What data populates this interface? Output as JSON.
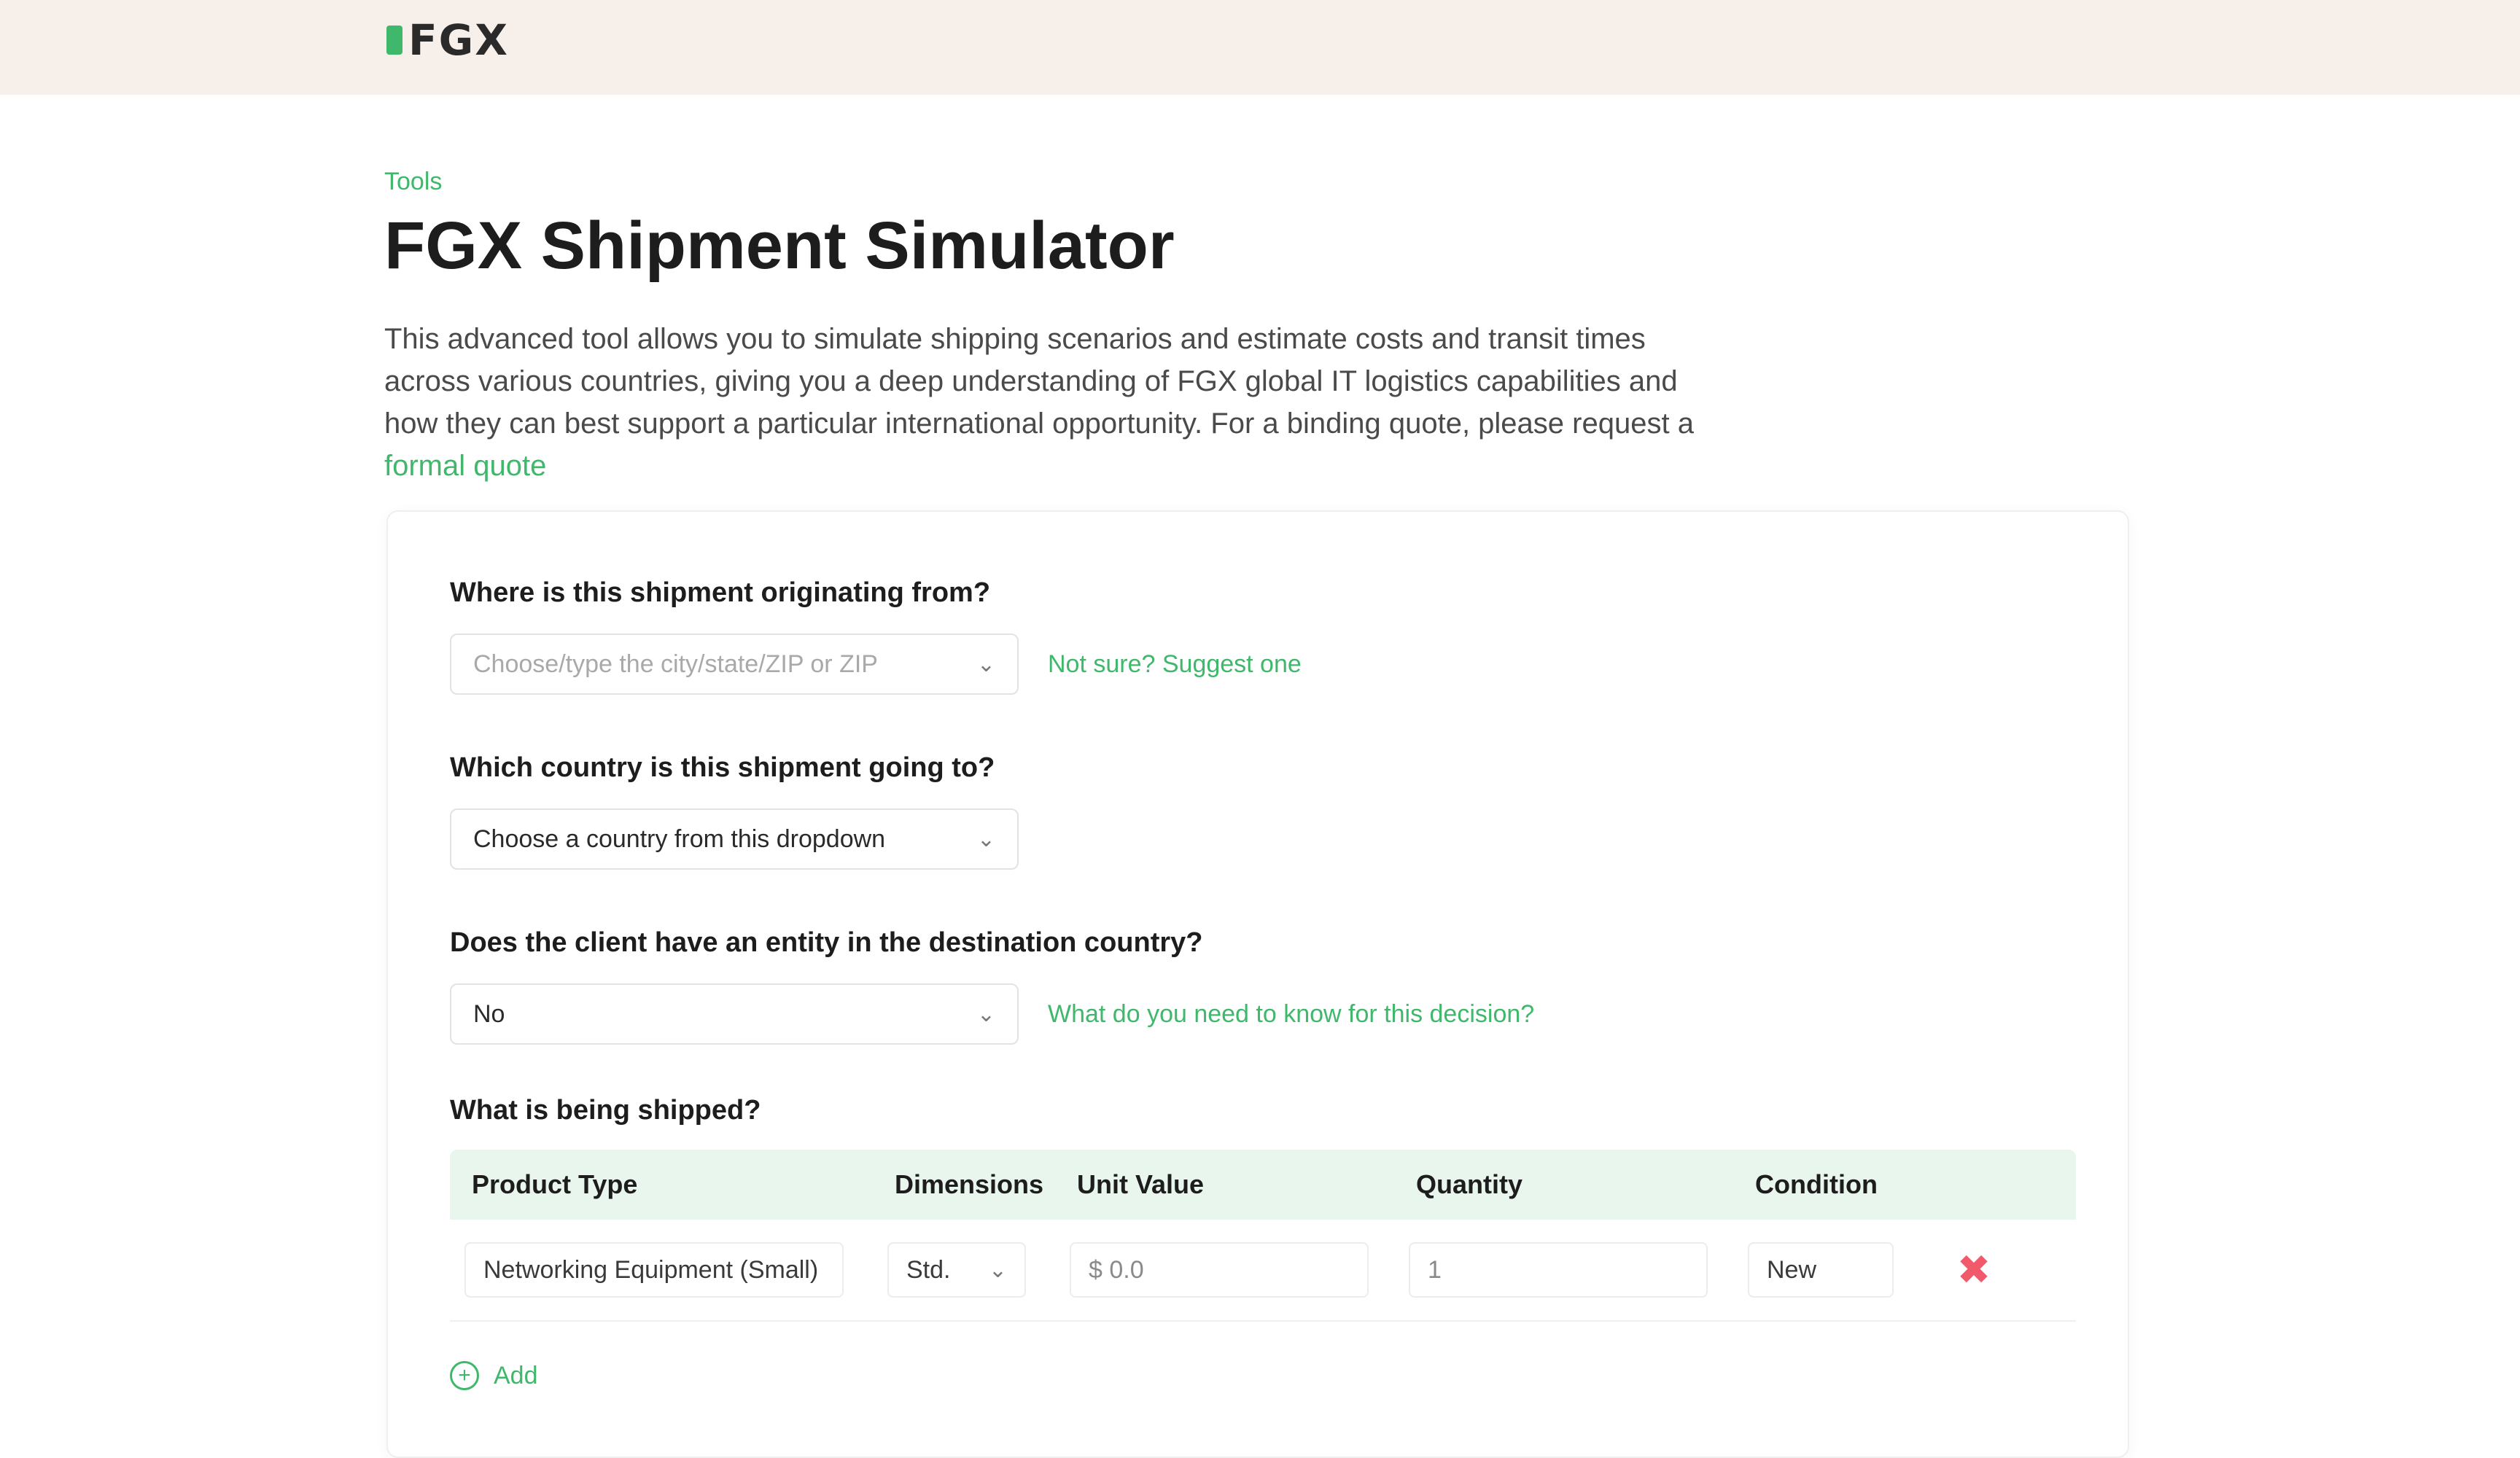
{
  "header": {
    "logo_text": "FGX"
  },
  "page": {
    "eyebrow": "Tools",
    "title": "FGX Shipment Simulator",
    "intro": "This advanced tool allows you to simulate shipping scenarios and estimate costs and transit times across various countries, giving you a deep understanding of FGX global IT logistics capabilities and how they can best support a particular international opportunity. For a binding quote, please request a",
    "intro_link": "formal quote"
  },
  "form": {
    "origin": {
      "label": "Where is this shipment originating from?",
      "placeholder": "Choose/type the city/state/ZIP or ZIP",
      "helper": "Not sure? Suggest one"
    },
    "destination": {
      "label": "Which country is this shipment going to?",
      "value": "Choose a country from this dropdown"
    },
    "entity": {
      "label": "Does the client have an entity in the destination country?",
      "value": "No",
      "helper": "What do you need to know for this decision?"
    },
    "items": {
      "label": "What is being shipped?",
      "columns": [
        "Product Type",
        "Dimensions",
        "Unit Value",
        "Quantity",
        "Condition"
      ],
      "rows": [
        {
          "product_type": "Networking Equipment (Small)",
          "dimensions": "Std.",
          "unit_value": "$ 0.0",
          "quantity": "1",
          "condition": "New"
        }
      ],
      "add_label": "Add"
    }
  },
  "icons": {
    "chevron": "chevron-down-icon",
    "delete": "trash-icon",
    "add": "plus-icon"
  },
  "colors": {
    "brand_green": "#3fb86b",
    "header_bg": "#f7efe9",
    "table_header_bg": "#e9f6ee",
    "danger": "#f05a6a"
  }
}
